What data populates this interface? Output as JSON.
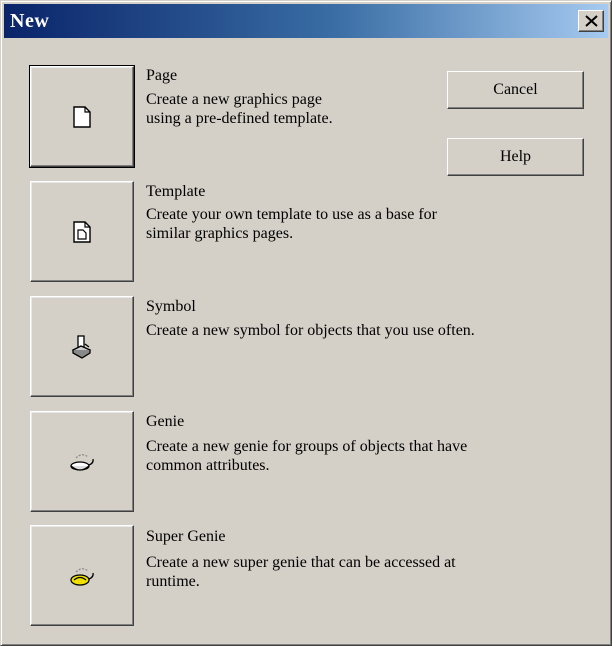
{
  "window": {
    "title": "New",
    "close_label": "×"
  },
  "buttons": {
    "cancel": "Cancel",
    "help": "Help"
  },
  "items": [
    {
      "title": "Page",
      "desc": "Create a new graphics page\nusing a pre-defined template.",
      "icon": "page-icon"
    },
    {
      "title": "Template",
      "desc": "Create your own template to use as a base for\nsimilar graphics pages.",
      "icon": "template-icon"
    },
    {
      "title": "Symbol",
      "desc": "Create a new symbol for objects that you use often.",
      "icon": "symbol-icon"
    },
    {
      "title": "Genie",
      "desc": "Create a new genie for groups of objects that have\ncommon attributes.",
      "icon": "genie-icon"
    },
    {
      "title": "Super Genie",
      "desc": "Create a new super genie that can be accessed at\nruntime.",
      "icon": "super-genie-icon"
    }
  ]
}
